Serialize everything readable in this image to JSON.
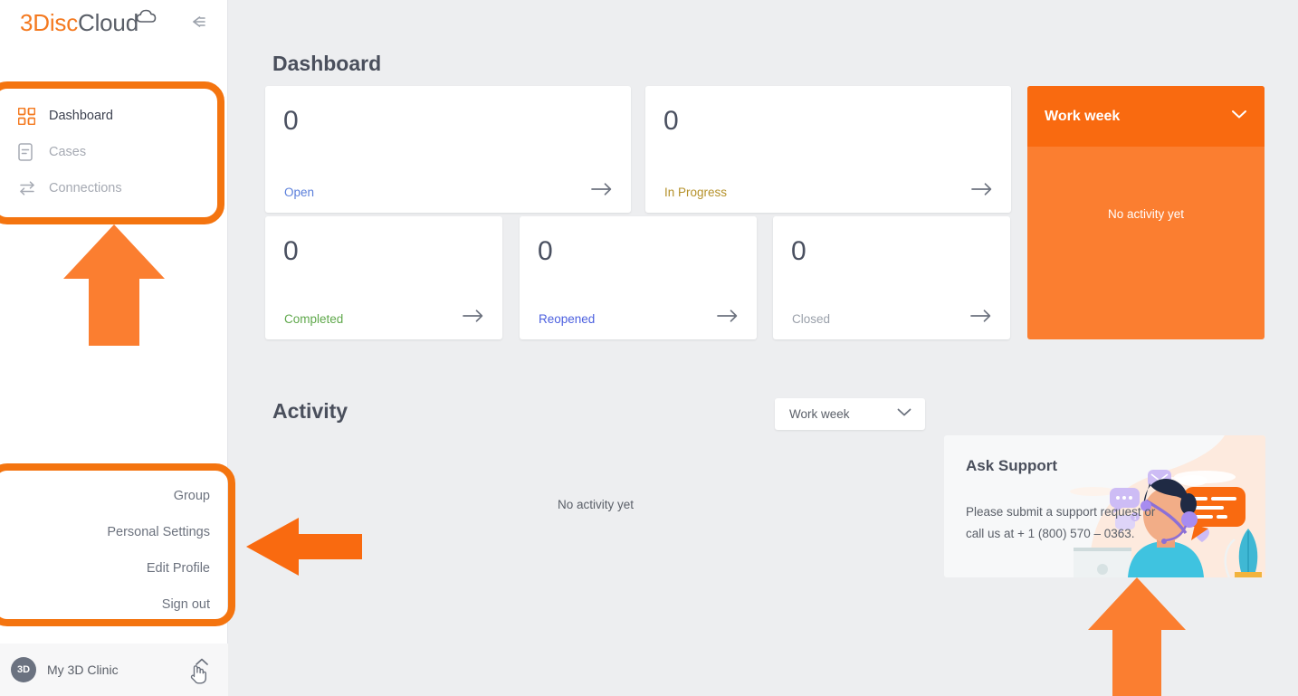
{
  "app": {
    "logo_primary": "3Disc",
    "logo_secondary": "Cloud",
    "accent_color": "#f4791f",
    "panel_orange": "#fb7e30",
    "panel_orange_dark": "#f96a10"
  },
  "sidebar": {
    "collapse_icon": "collapse-left-icon",
    "nav": [
      {
        "label": "Dashboard",
        "icon": "grid-squares-icon",
        "active": true
      },
      {
        "label": "Cases",
        "icon": "document-icon",
        "active": false
      },
      {
        "label": "Connections",
        "icon": "exchange-arrows-icon",
        "active": false
      }
    ],
    "user_menu": [
      {
        "label": "Group"
      },
      {
        "label": "Personal Settings"
      },
      {
        "label": "Edit Profile"
      },
      {
        "label": "Sign out"
      }
    ],
    "account": {
      "avatar_initials": "3D",
      "name": "My 3D Clinic",
      "caret_icon": "chevron-up-icon",
      "cursor_icon": "pointer-hand-icon"
    }
  },
  "main": {
    "dashboard_title": "Dashboard",
    "activity_title": "Activity",
    "stat_cards": [
      {
        "value": "0",
        "label": "Open",
        "color": "#5b7fdb"
      },
      {
        "value": "0",
        "label": "In Progress",
        "color": "#b5912a"
      },
      {
        "value": "0",
        "label": "Completed",
        "color": "#5fa84b"
      },
      {
        "value": "0",
        "label": "Reopened",
        "color": "#4b5fdf"
      },
      {
        "value": "0",
        "label": "Closed",
        "color": "#9aa0aa"
      }
    ],
    "work_week_panel": {
      "title": "Work week",
      "chevron_icon": "chevron-down-icon",
      "empty_text": "No activity yet"
    },
    "activity_filter": {
      "selected": "Work week",
      "chevron_icon": "chevron-down-icon"
    },
    "activity_empty": "No activity yet",
    "support": {
      "title": "Ask Support",
      "text": "Please submit a support request or call us at + 1 (800) 570 – 0363."
    }
  },
  "annotations": {
    "arrow_color": "#fb7e30",
    "arrow_color_strong": "#f96a10",
    "box_color": "#f4740f",
    "items": [
      {
        "name": "arrow-up-nav"
      },
      {
        "name": "arrow-left-user-menu"
      },
      {
        "name": "arrow-up-support"
      }
    ]
  }
}
